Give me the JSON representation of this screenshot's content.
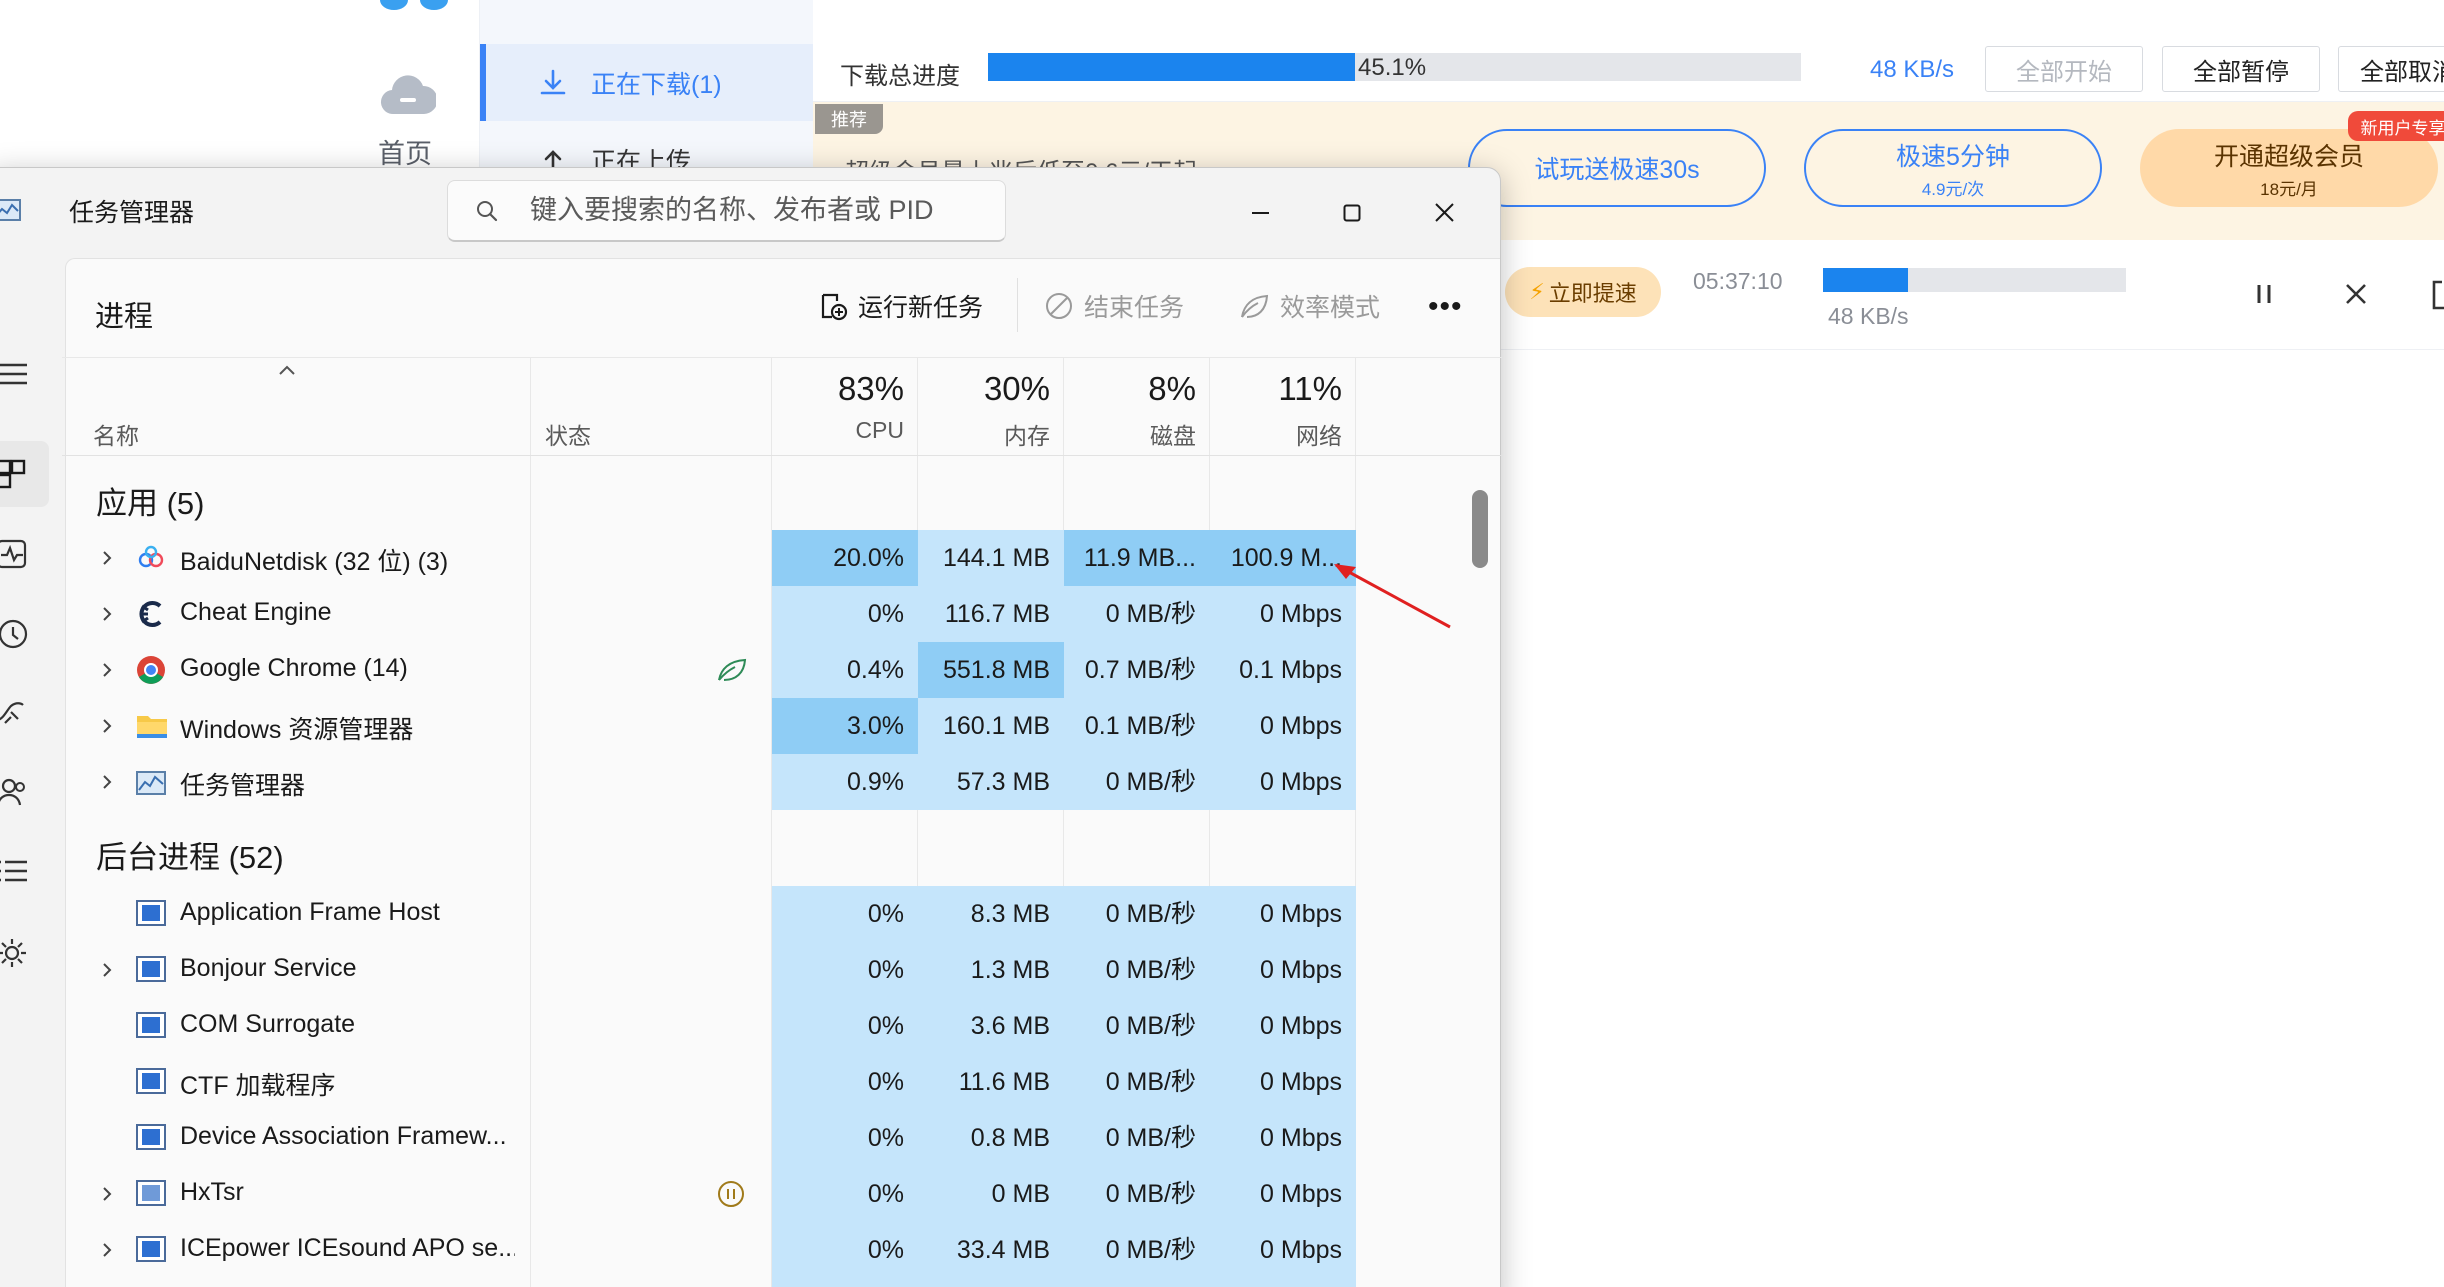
{
  "download_app": {
    "nav_home": "首页",
    "nav_downloading": "正在下载(1)",
    "nav_uploading": "正在上传",
    "total_progress_label": "下载总进度",
    "total_progress_text": "45.1%",
    "total_progress_value": 0.451,
    "speed": "48 KB/s",
    "btn_start_all": "全部开始",
    "btn_pause_all": "全部暂停",
    "btn_cancel_all": "全部取消",
    "promo_tag": "推荐",
    "promo_text": "超级会员最上兆后低至0.6元/天起",
    "pill1_label": "试玩送极速30s",
    "pill2_label": "极速5分钟",
    "pill2_sub": "4.9元/次",
    "pill3_label": "开通超级会员",
    "pill3_sub": "18元/月",
    "new_user_tag": "新用户专享",
    "boost_label": "立即提速",
    "item_time": "05:37:10",
    "item_progress_value": 0.28,
    "item_speed": "48 KB/s"
  },
  "taskmgr": {
    "title": "任务管理器",
    "search_placeholder": "键入要搜索的名称、发布者或 PID",
    "page_title": "进程",
    "cmd_run_new": "运行新任务",
    "cmd_end_task": "结束任务",
    "cmd_efficiency": "效率模式",
    "cmd_more": "•••",
    "col_name": "名称",
    "col_status": "状态",
    "cpu_pct": "83%",
    "cpu_label": "CPU",
    "mem_pct": "30%",
    "mem_label": "内存",
    "disk_pct": "8%",
    "disk_label": "磁盘",
    "net_pct": "11%",
    "net_label": "网络",
    "group_apps": "应用 (5)",
    "group_bg": "后台进程 (52)",
    "apps": [
      {
        "name": "BaiduNetdisk (32 位) (3)",
        "cpu": "20.0%",
        "mem": "144.1 MB",
        "disk": "11.9 MB...",
        "net": "100.9 M..."
      },
      {
        "name": "Cheat Engine",
        "cpu": "0%",
        "mem": "116.7 MB",
        "disk": "0 MB/秒",
        "net": "0 Mbps"
      },
      {
        "name": "Google Chrome (14)",
        "cpu": "0.4%",
        "mem": "551.8 MB",
        "disk": "0.7 MB/秒",
        "net": "0.1 Mbps"
      },
      {
        "name": "Windows 资源管理器",
        "cpu": "3.0%",
        "mem": "160.1 MB",
        "disk": "0.1 MB/秒",
        "net": "0 Mbps"
      },
      {
        "name": "任务管理器",
        "cpu": "0.9%",
        "mem": "57.3 MB",
        "disk": "0 MB/秒",
        "net": "0 Mbps"
      }
    ],
    "bg": [
      {
        "name": "Application Frame Host",
        "cpu": "0%",
        "mem": "8.3 MB",
        "disk": "0 MB/秒",
        "net": "0 Mbps"
      },
      {
        "name": "Bonjour Service",
        "cpu": "0%",
        "mem": "1.3 MB",
        "disk": "0 MB/秒",
        "net": "0 Mbps"
      },
      {
        "name": "COM Surrogate",
        "cpu": "0%",
        "mem": "3.6 MB",
        "disk": "0 MB/秒",
        "net": "0 Mbps"
      },
      {
        "name": "CTF 加载程序",
        "cpu": "0%",
        "mem": "11.6 MB",
        "disk": "0 MB/秒",
        "net": "0 Mbps"
      },
      {
        "name": "Device Association Framew...",
        "cpu": "0%",
        "mem": "0.8 MB",
        "disk": "0 MB/秒",
        "net": "0 Mbps"
      },
      {
        "name": "HxTsr",
        "cpu": "0%",
        "mem": "0 MB",
        "disk": "0 MB/秒",
        "net": "0 Mbps"
      },
      {
        "name": "ICEpower ICEsound APO se...",
        "cpu": "0%",
        "mem": "33.4 MB",
        "disk": "0 MB/秒",
        "net": "0 Mbps"
      }
    ]
  }
}
